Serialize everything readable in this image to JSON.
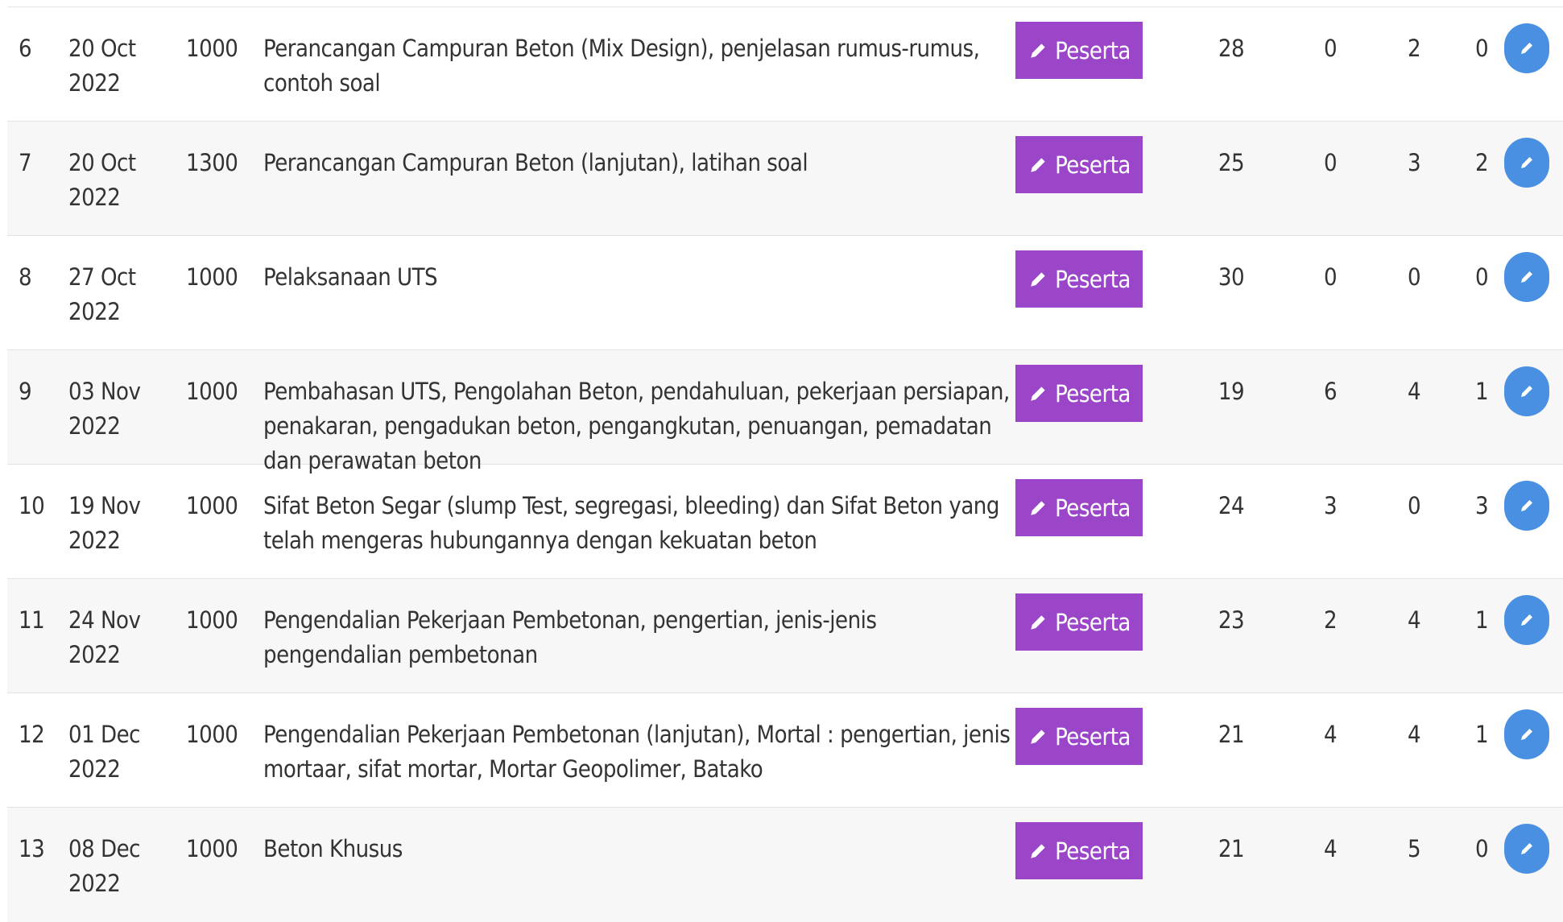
{
  "colors": {
    "peserta_button": "#9b45c9",
    "edit_button": "#4a90e2",
    "stripe": "#f7f7f7",
    "text": "#333333"
  },
  "icons": {
    "peserta": "pencil-icon",
    "edit": "pencil-icon"
  },
  "rows": [
    {
      "no": "6",
      "date_line1": "20 Oct",
      "date_line2": "2022",
      "time": "1000",
      "topic": "Perancangan Campuran Beton (Mix Design), penjelasan rumus-rumus, contoh soal",
      "button": "Peserta",
      "n1": "28",
      "n2": "0",
      "n3": "2",
      "n4": "0"
    },
    {
      "no": "7",
      "date_line1": "20 Oct",
      "date_line2": "2022",
      "time": "1300",
      "topic": "Perancangan Campuran Beton (lanjutan), latihan soal",
      "button": "Peserta",
      "n1": "25",
      "n2": "0",
      "n3": "3",
      "n4": "2"
    },
    {
      "no": "8",
      "date_line1": "27 Oct",
      "date_line2": "2022",
      "time": "1000",
      "topic": "Pelaksanaan UTS",
      "button": "Peserta",
      "n1": "30",
      "n2": "0",
      "n3": "0",
      "n4": "0"
    },
    {
      "no": "9",
      "date_line1": "03 Nov",
      "date_line2": "2022",
      "time": "1000",
      "topic": "Pembahasan UTS, Pengolahan Beton, pendahuluan, pekerjaan persiapan, penakaran, pengadukan beton, pengangkutan, penuangan, pemadatan dan perawatan beton",
      "button": "Peserta",
      "n1": "19",
      "n2": "6",
      "n3": "4",
      "n4": "1"
    },
    {
      "no": "10",
      "date_line1": "19 Nov",
      "date_line2": "2022",
      "time": "1000",
      "topic": "Sifat Beton Segar (slump Test, segregasi, bleeding) dan Sifat Beton yang telah mengeras hubungannya dengan kekuatan beton",
      "button": "Peserta",
      "n1": "24",
      "n2": "3",
      "n3": "0",
      "n4": "3"
    },
    {
      "no": "11",
      "date_line1": "24 Nov",
      "date_line2": "2022",
      "time": "1000",
      "topic": "Pengendalian Pekerjaan Pembetonan, pengertian, jenis-jenis pengendalian pembetonan",
      "button": "Peserta",
      "n1": "23",
      "n2": "2",
      "n3": "4",
      "n4": "1"
    },
    {
      "no": "12",
      "date_line1": "01 Dec",
      "date_line2": "2022",
      "time": "1000",
      "topic": "Pengendalian Pekerjaan Pembetonan (lanjutan), Mortal : pengertian, jenis mortaar, sifat mortar, Mortar Geopolimer, Batako",
      "button": "Peserta",
      "n1": "21",
      "n2": "4",
      "n3": "4",
      "n4": "1"
    },
    {
      "no": "13",
      "date_line1": "08 Dec",
      "date_line2": "2022",
      "time": "1000",
      "topic": "Beton Khusus",
      "button": "Peserta",
      "n1": "21",
      "n2": "4",
      "n3": "5",
      "n4": "0"
    }
  ]
}
